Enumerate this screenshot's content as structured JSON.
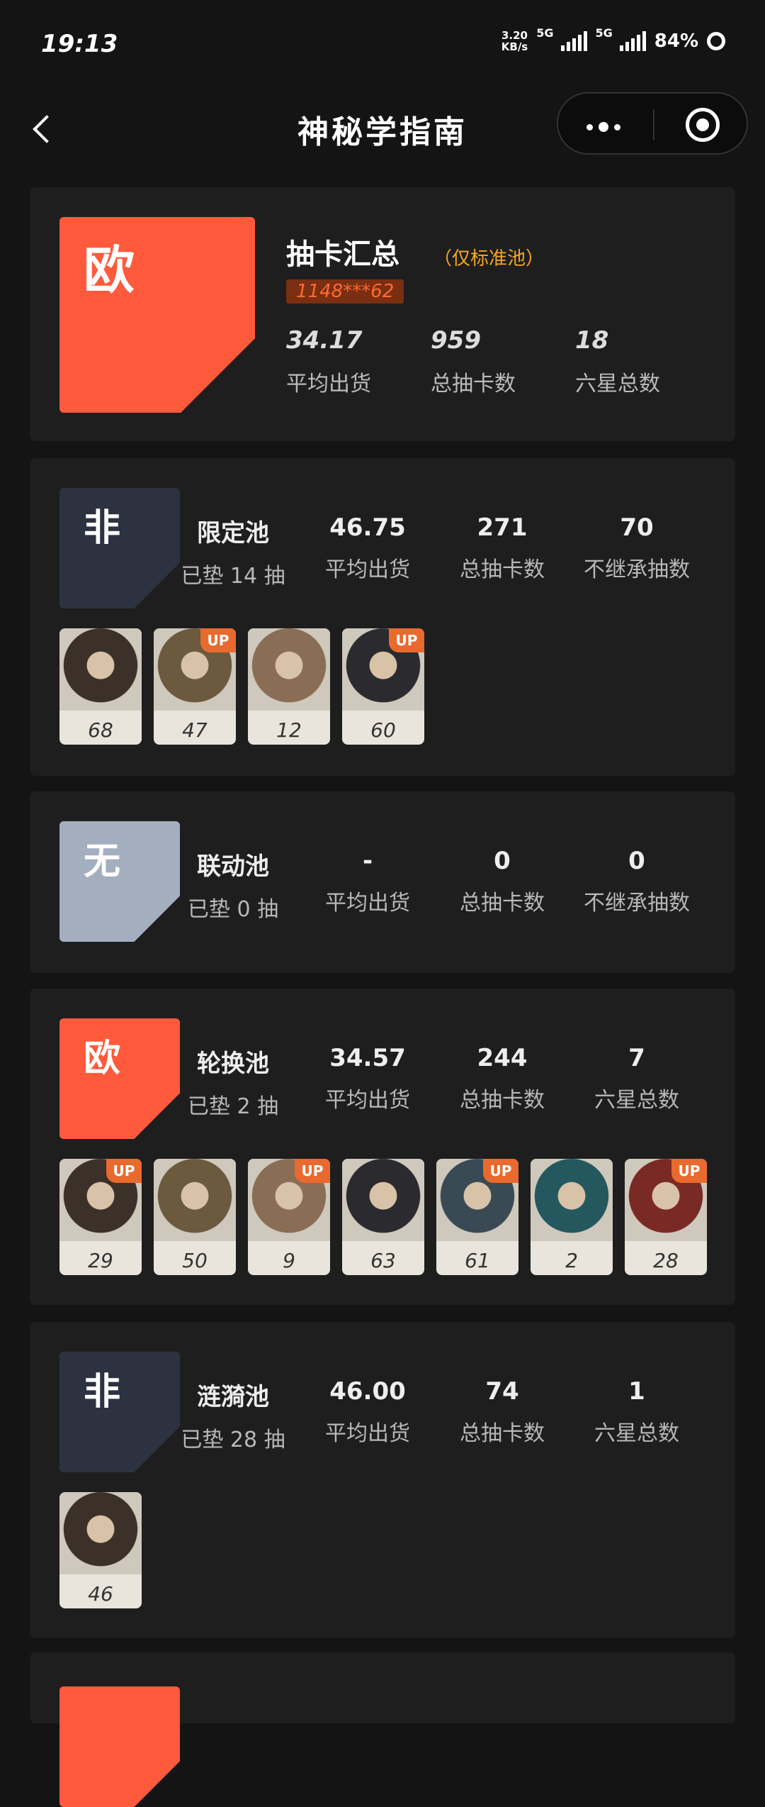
{
  "status": {
    "time": "19:13",
    "net_speed_top": "3.20",
    "net_speed_bottom": "KB/s",
    "sig1": "5G",
    "sig2": "5G",
    "battery": "84%"
  },
  "nav": {
    "title": "神秘学指南"
  },
  "colors": {
    "ou": "#ff5a3c",
    "fei": "#2d3240",
    "wu": "#a3afbf",
    "up": "#e96a2e"
  },
  "summary": {
    "badge": "欧",
    "title": "抽卡汇总",
    "note": "（仅标准池）",
    "uid": "1148***62",
    "stats": [
      {
        "value": "34.17",
        "label": "平均出货"
      },
      {
        "value": "959",
        "label": "总抽卡数"
      },
      {
        "value": "18",
        "label": "六星总数"
      }
    ]
  },
  "pools": [
    {
      "badge": "非",
      "badge_color": "fei",
      "name": "限定池",
      "pity": "已垫 14 抽",
      "stats": [
        {
          "value": "46.75",
          "label": "平均出货"
        },
        {
          "value": "271",
          "label": "总抽卡数"
        },
        {
          "value": "70",
          "label": "不继承抽数"
        }
      ],
      "chars": [
        {
          "num": "68",
          "up": false,
          "icon": "portrait-dark-hair-man"
        },
        {
          "num": "47",
          "up": true,
          "icon": "portrait-blonde-girl"
        },
        {
          "num": "12",
          "up": false,
          "icon": "portrait-hat-girl"
        },
        {
          "num": "60",
          "up": true,
          "icon": "portrait-black-hair-woman"
        }
      ]
    },
    {
      "badge": "无",
      "badge_color": "wu",
      "name": "联动池",
      "pity": "已垫 0 抽",
      "stats": [
        {
          "value": "-",
          "label": "平均出货"
        },
        {
          "value": "0",
          "label": "总抽卡数"
        },
        {
          "value": "0",
          "label": "不继承抽数"
        }
      ],
      "chars": []
    },
    {
      "badge": "欧",
      "badge_color": "ou",
      "name": "轮换池",
      "pity": "已垫 2 抽",
      "stats": [
        {
          "value": "34.57",
          "label": "平均出货"
        },
        {
          "value": "244",
          "label": "总抽卡数"
        },
        {
          "value": "7",
          "label": "六星总数"
        }
      ],
      "chars": [
        {
          "num": "29",
          "up": true,
          "icon": "portrait-dark-hair-man"
        },
        {
          "num": "50",
          "up": false,
          "icon": "portrait-sunglasses-girl"
        },
        {
          "num": "9",
          "up": true,
          "icon": "portrait-pale-woman"
        },
        {
          "num": "63",
          "up": false,
          "icon": "portrait-hat-woman"
        },
        {
          "num": "61",
          "up": true,
          "icon": "portrait-black-hair-man"
        },
        {
          "num": "2",
          "up": false,
          "icon": "portrait-teal-hair-woman"
        },
        {
          "num": "28",
          "up": true,
          "icon": "portrait-red-hair-woman"
        }
      ]
    },
    {
      "badge": "非",
      "badge_color": "fei",
      "name": "涟漪池",
      "pity": "已垫 28 抽",
      "stats": [
        {
          "value": "46.00",
          "label": "平均出货"
        },
        {
          "value": "74",
          "label": "总抽卡数"
        },
        {
          "value": "1",
          "label": "六星总数"
        }
      ],
      "chars": [
        {
          "num": "46",
          "up": false,
          "icon": "portrait-grey-hair-girl"
        }
      ]
    }
  ]
}
